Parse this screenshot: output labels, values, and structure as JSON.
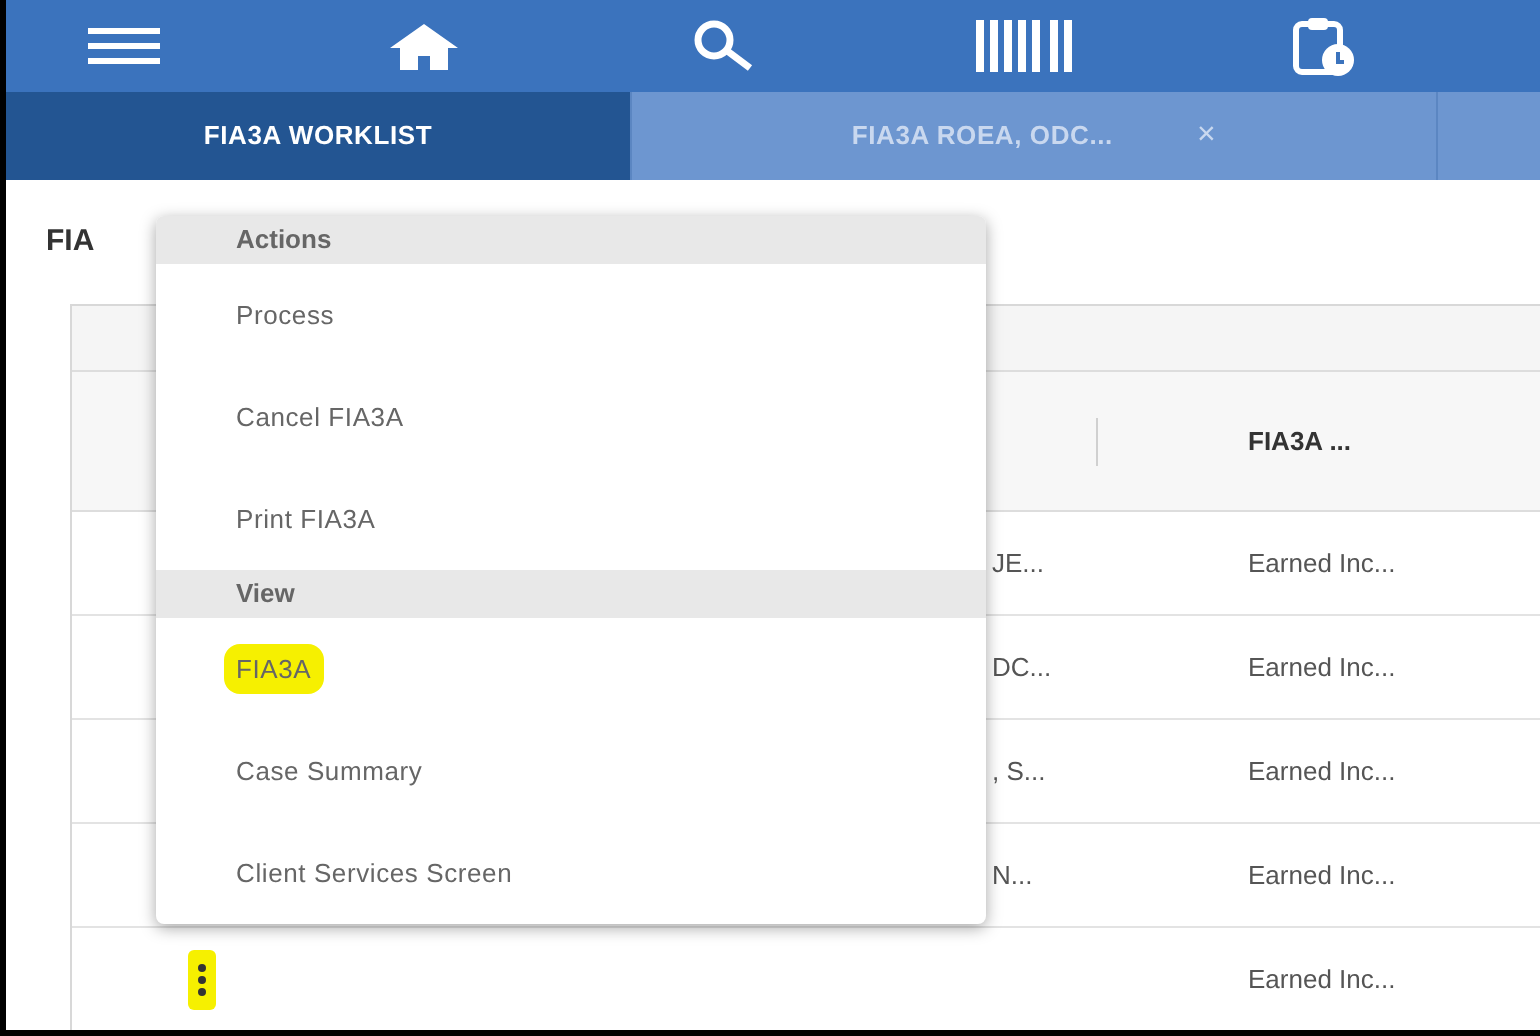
{
  "toolbar": {
    "icons": [
      {
        "kind": "menu"
      },
      {
        "kind": "home"
      },
      {
        "kind": "search"
      },
      {
        "kind": "barcode"
      },
      {
        "kind": "clipboard"
      }
    ]
  },
  "tabs": [
    {
      "label": "FIA3A WORKLIST",
      "selected": true
    },
    {
      "label": "FIA3A ROEA, ODC...",
      "selected": false,
      "close": "×"
    },
    {
      "selected": false
    }
  ],
  "page_title": "FIA",
  "table": {
    "header": "FIA3A ...",
    "rows": [
      {
        "column_2": "JE...",
        "column_3": "Earned Inc..."
      },
      {
        "column_2": "DC...",
        "column_3": "Earned Inc..."
      },
      {
        "column_2": ", S...",
        "column_3": "Earned Inc..."
      },
      {
        "column_2": "N...",
        "column_3": "Earned Inc..."
      },
      {
        "column_3": "Earned Inc...",
        "menu_button": true,
        "highlighted": true
      }
    ]
  },
  "menu": {
    "sections": [
      {
        "title": "Actions",
        "items": [
          {
            "label": "Process",
            "highlighted": false
          },
          {
            "label": "Cancel FIA3A",
            "highlighted": false
          },
          {
            "label": "Print FIA3A",
            "highlighted": false
          }
        ]
      },
      {
        "title": "View",
        "items": [
          {
            "label": "FIA3A",
            "highlighted": true
          },
          {
            "label": "Case Summary",
            "highlighted": false
          },
          {
            "label": "Client Services Screen",
            "highlighted": false
          }
        ]
      }
    ]
  }
}
